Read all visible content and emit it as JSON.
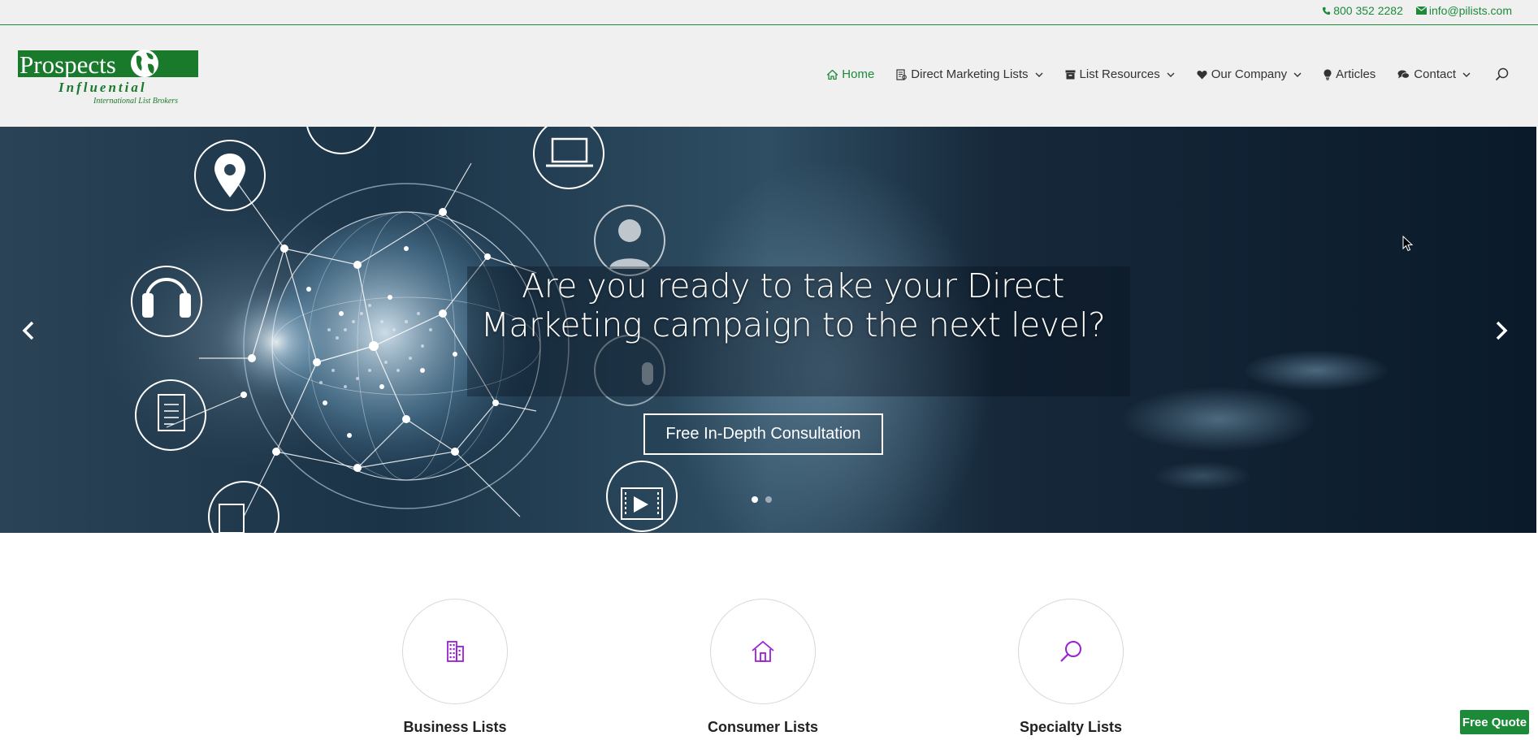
{
  "topbar": {
    "phone": "800 352 2282",
    "email": "info@pilists.com",
    "phone_icon": "phone-icon",
    "email_icon": "envelope-icon"
  },
  "logo": {
    "line1": "Prospects",
    "line2": "Influential",
    "line3": "International List Brokers"
  },
  "nav": {
    "items": [
      {
        "label": "Home",
        "icon": "home-icon",
        "has_caret": false,
        "active": true
      },
      {
        "label": "Direct Marketing Lists",
        "icon": "list-icon",
        "has_caret": true
      },
      {
        "label": "List Resources",
        "icon": "archive-icon",
        "has_caret": true
      },
      {
        "label": "Our Company",
        "icon": "heart-icon",
        "has_caret": true
      },
      {
        "label": "Articles",
        "icon": "lightbulb-icon",
        "has_caret": false
      },
      {
        "label": "Contact",
        "icon": "chat-icon",
        "has_caret": true
      }
    ],
    "search_icon": "search-icon"
  },
  "hero": {
    "heading_line1": "Are you ready to take your Direct",
    "heading_line2": "Marketing campaign to the next level?",
    "button_label": "Free In-Depth Consultation",
    "slide_count": 2,
    "active_slide": 1
  },
  "features": [
    {
      "title": "Business Lists",
      "icon": "building-icon"
    },
    {
      "title": "Consumer Lists",
      "icon": "house-icon"
    },
    {
      "title": "Specialty Lists",
      "icon": "search-icon"
    }
  ],
  "quote_button": "Free Quote",
  "colors": {
    "brand_green": "#1d8a3a",
    "icon_purple": "#9b1fd6",
    "header_bg": "#f0f0f0"
  }
}
